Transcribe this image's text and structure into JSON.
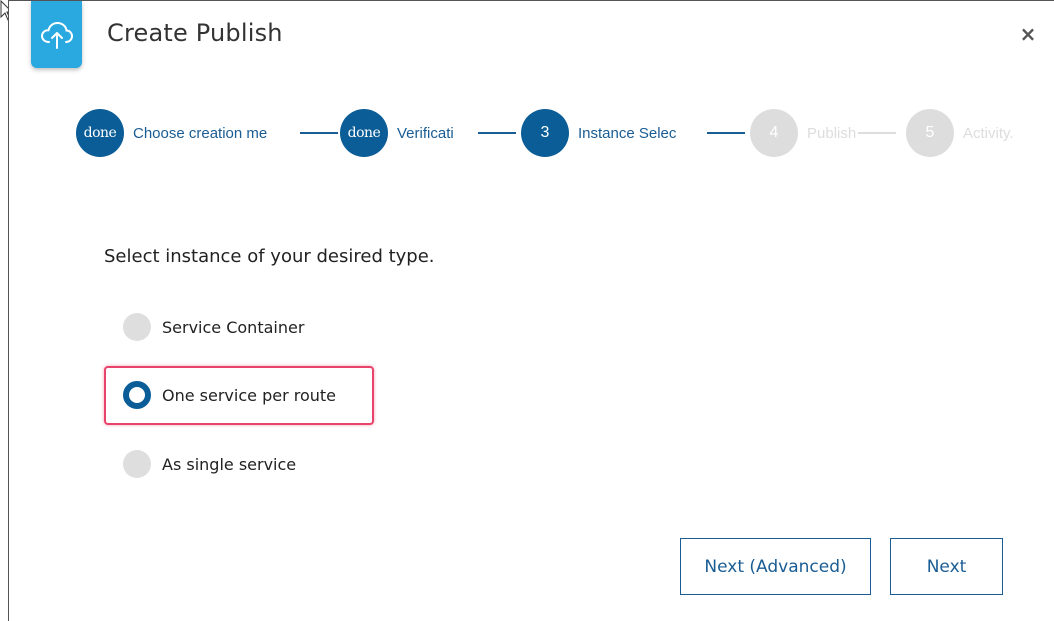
{
  "dialog": {
    "title": "Create Publish",
    "close_symbol": "×",
    "app_icon": "cloud-upload-icon"
  },
  "stepper": {
    "steps": [
      {
        "badge": "done",
        "label": "Choose creation me",
        "state": "done"
      },
      {
        "badge": "done",
        "label": "Verificati",
        "state": "done"
      },
      {
        "badge": "3",
        "label": "Instance Selec",
        "state": "active"
      },
      {
        "badge": "4",
        "label": "Publish",
        "state": "inactive"
      },
      {
        "badge": "5",
        "label": "Activity.",
        "state": "inactive"
      }
    ]
  },
  "form": {
    "prompt": "Select instance of your desired type.",
    "options": [
      {
        "label": "Service Container",
        "checked": false
      },
      {
        "label": "One service per route",
        "checked": true
      },
      {
        "label": "As single service",
        "checked": false
      }
    ]
  },
  "footer": {
    "next_advanced_label": "Next (Advanced)",
    "next_label": "Next"
  },
  "colors": {
    "primary": "#0a5d96",
    "accent_icon_bg": "#29a9e0",
    "inactive": "#dddddd",
    "highlight": "#e8436a"
  }
}
